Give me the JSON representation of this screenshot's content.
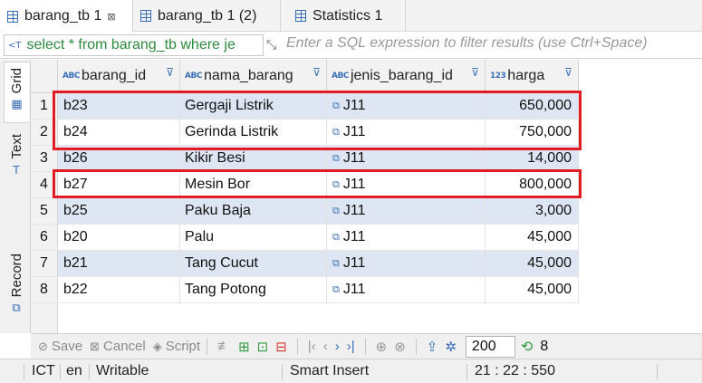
{
  "tabs": [
    {
      "label": "barang_tb 1",
      "close": "⊠"
    },
    {
      "label": "barang_tb 1 (2)"
    },
    {
      "label": "Statistics 1"
    }
  ],
  "filter": {
    "sql": "select * from barang_tb where je",
    "placeholder": "Enter a SQL expression to filter results (use Ctrl+Space)"
  },
  "side_tabs": {
    "grid": "Grid",
    "text": "Text",
    "record": "Record"
  },
  "columns": [
    {
      "name": "barang_id",
      "type_icon": "ABC"
    },
    {
      "name": "nama_barang",
      "type_icon": "ABC"
    },
    {
      "name": "jenis_barang_id",
      "type_icon": "ABC"
    },
    {
      "name": "harga",
      "type_icon": "123"
    }
  ],
  "rows": [
    {
      "num": "1",
      "barang_id": "b23",
      "nama_barang": "Gergaji Listrik",
      "jenis_barang_id": "J11",
      "harga": "650,000"
    },
    {
      "num": "2",
      "barang_id": "b24",
      "nama_barang": "Gerinda Listrik",
      "jenis_barang_id": "J11",
      "harga": "750,000"
    },
    {
      "num": "3",
      "barang_id": "b26",
      "nama_barang": "Kikir Besi",
      "jenis_barang_id": "J11",
      "harga": "14,000"
    },
    {
      "num": "4",
      "barang_id": "b27",
      "nama_barang": "Mesin Bor",
      "jenis_barang_id": "J11",
      "harga": "800,000"
    },
    {
      "num": "5",
      "barang_id": "b25",
      "nama_barang": "Paku Baja",
      "jenis_barang_id": "J11",
      "harga": "3,000"
    },
    {
      "num": "6",
      "barang_id": "b20",
      "nama_barang": "Palu",
      "jenis_barang_id": "J11",
      "harga": "45,000"
    },
    {
      "num": "7",
      "barang_id": "b21",
      "nama_barang": "Tang Cucut",
      "jenis_barang_id": "J11",
      "harga": "45,000"
    },
    {
      "num": "8",
      "barang_id": "b22",
      "nama_barang": "Tang Potong",
      "jenis_barang_id": "J11",
      "harga": "45,000"
    }
  ],
  "toolbar": {
    "save": "Save",
    "cancel": "Cancel",
    "script": "Script",
    "limit": "200",
    "row_count": "8"
  },
  "status": {
    "timezone": "ICT",
    "locale": "en",
    "mode": "Writable",
    "insert_mode": "Smart Insert",
    "position": "21 : 22 : 550"
  },
  "colors": {
    "highlight": "#e31b23",
    "accent": "#3a6fb7",
    "selected_row": "#dde6f2"
  }
}
